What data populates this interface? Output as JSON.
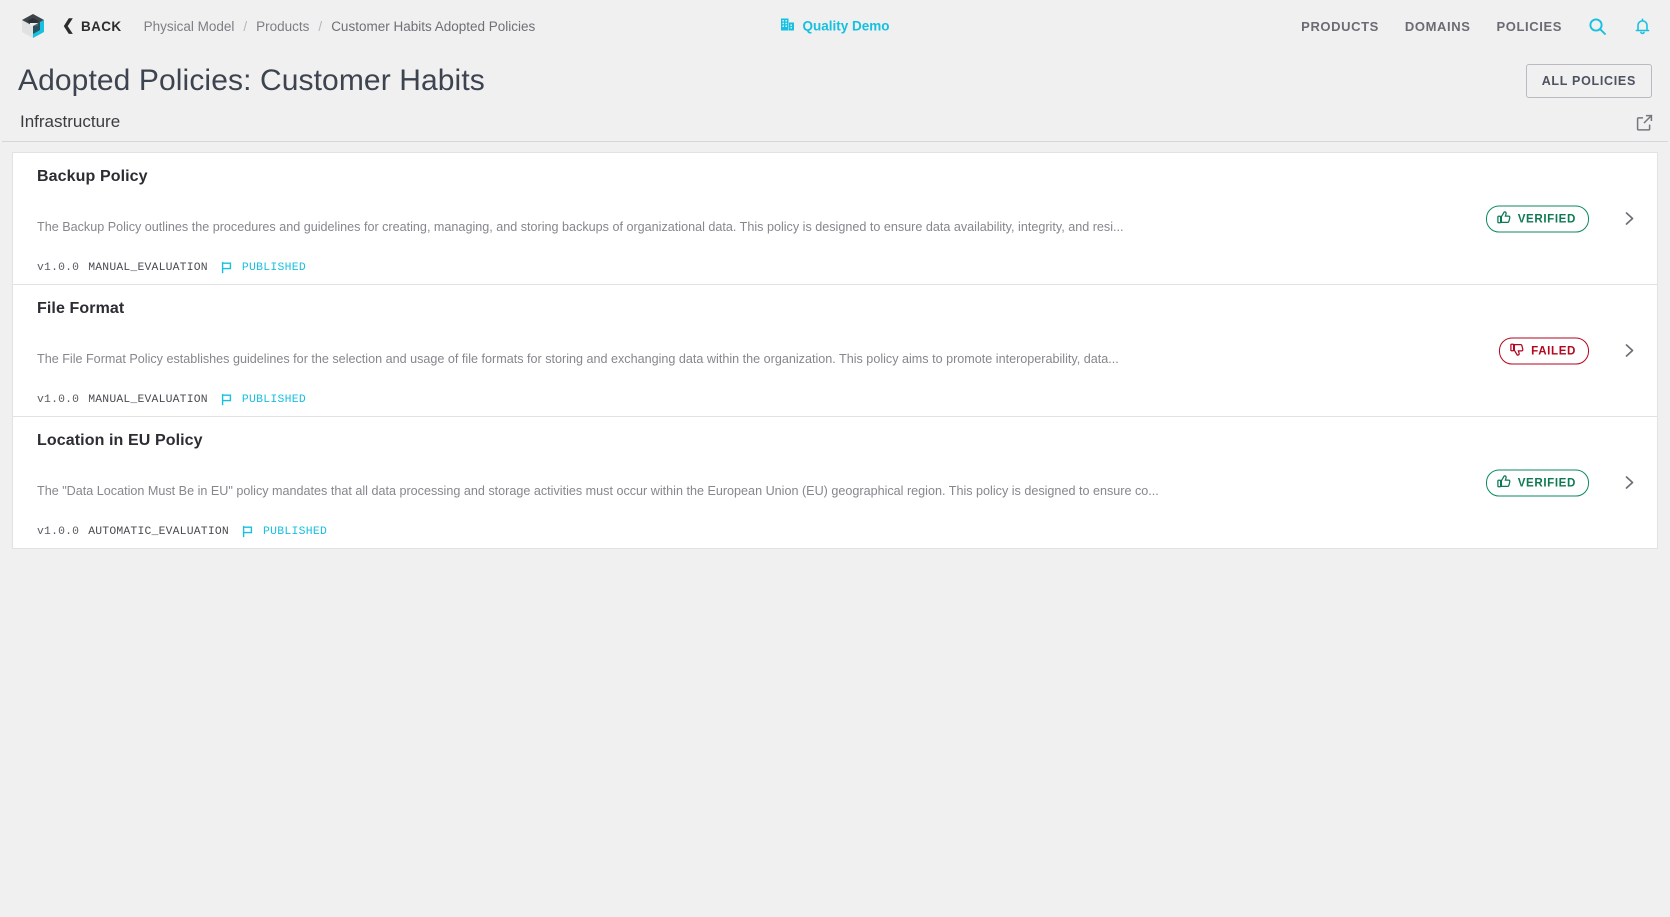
{
  "topbar": {
    "logo_icon": "cube-logo-icon",
    "back_label": "BACK",
    "back_icon": "chevron-left-icon",
    "breadcrumb": [
      {
        "label": "Physical Model"
      },
      {
        "label": "Products"
      },
      {
        "label": "Customer Habits Adopted Policies"
      }
    ],
    "separator": "/",
    "brand": {
      "label": "Quality Demo",
      "icon": "domain-building-icon"
    },
    "nav": [
      {
        "label": "PRODUCTS"
      },
      {
        "label": "DOMAINS"
      },
      {
        "label": "POLICIES"
      }
    ],
    "search_icon": "search-icon",
    "notifications_icon": "bell-icon",
    "accent_color": "#16c0e0"
  },
  "page": {
    "title": "Adopted Policies: Customer Habits",
    "all_policies_label": "ALL POLICIES"
  },
  "section": {
    "title": "Infrastructure",
    "action_icon": "open-in-new-icon"
  },
  "policies": [
    {
      "title": "Backup Policy",
      "description": "The Backup Policy outlines the procedures and guidelines for creating, managing, and storing backups of organizational data. This policy is designed to ensure data availability, integrity, and resi...",
      "version": "v1.0.0",
      "evaluation": "MANUAL_EVALUATION",
      "flag_icon": "flag-icon",
      "status": "PUBLISHED",
      "badge": {
        "label": "VERIFIED",
        "icon": "thumb-up-icon",
        "kind": "verified",
        "color": "#0e7a52"
      },
      "chevron_icon": "chevron-right-icon"
    },
    {
      "title": "File Format",
      "description": "The File Format Policy establishes guidelines for the selection and usage of file formats for storing and exchanging data within the organization. This policy aims to promote interoperability, data...",
      "version": "v1.0.0",
      "evaluation": "MANUAL_EVALUATION",
      "flag_icon": "flag-icon",
      "status": "PUBLISHED",
      "badge": {
        "label": "FAILED",
        "icon": "thumb-down-icon",
        "kind": "failed",
        "color": "#b3061f"
      },
      "chevron_icon": "chevron-right-icon"
    },
    {
      "title": "Location in EU Policy",
      "description": "The \"Data Location Must Be in EU\" policy mandates that all data processing and storage activities must occur within the European Union (EU) geographical region. This policy is designed to ensure co...",
      "version": "v1.0.0",
      "evaluation": "AUTOMATIC_EVALUATION",
      "flag_icon": "flag-icon",
      "status": "PUBLISHED",
      "badge": {
        "label": "VERIFIED",
        "icon": "thumb-up-icon",
        "kind": "verified",
        "color": "#0e7a52"
      },
      "chevron_icon": "chevron-right-icon"
    }
  ]
}
